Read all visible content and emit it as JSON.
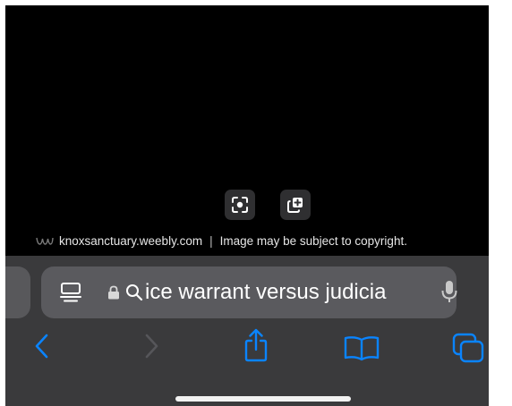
{
  "image_viewer": {
    "visual_lookup_icon": "viewfinder-face-icon",
    "copy_subject_icon": "plus-square-on-square-icon",
    "source_site_icon": "weebly-logo-icon",
    "source_domain": "knoxsanctuary.weebly.com",
    "separator": "|",
    "copyright_notice": "Image may be subject to copyright."
  },
  "address_bar": {
    "reader_icon": "reader-mode-icon",
    "lock_icon": "lock-icon",
    "search_icon": "search-icon",
    "query_text": "ice warrant versus judicia",
    "mic_icon": "microphone-icon"
  },
  "bottom_toolbar": {
    "buttons": [
      "back-icon",
      "forward-icon",
      "share-icon",
      "bookmarks-icon",
      "tabs-icon"
    ]
  },
  "colors": {
    "background": "#000000",
    "toolbar": "#3a3a3c",
    "address_bar": "#5a5a5e",
    "accent": "#0a84ff"
  }
}
